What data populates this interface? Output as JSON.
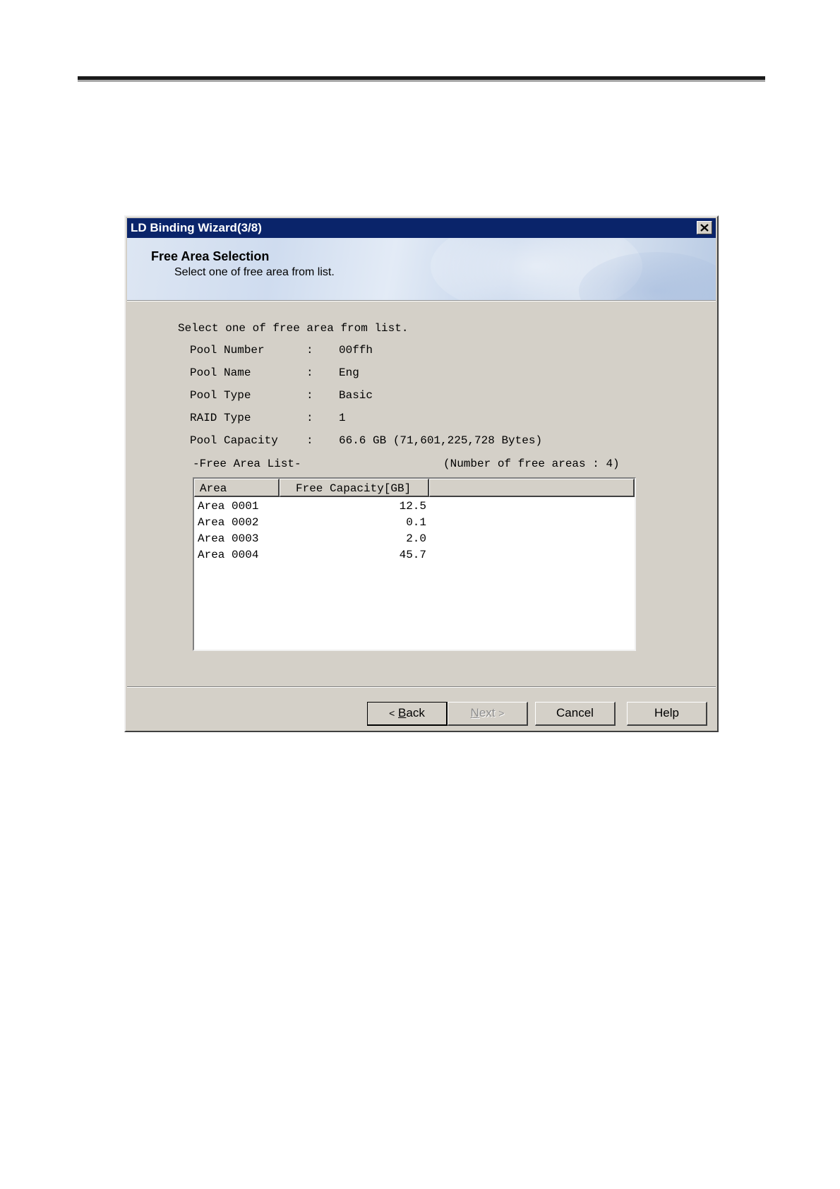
{
  "window": {
    "title": "LD Binding Wizard(3/8)",
    "close_glyph": "close-icon"
  },
  "banner": {
    "title": "Free Area Selection",
    "subtitle": "Select one of free area from list."
  },
  "body": {
    "intro": "Select one of free area from list.",
    "info": [
      {
        "label": "Pool Number",
        "colon": ":",
        "value": "00ffh"
      },
      {
        "label": "Pool Name",
        "colon": ":",
        "value": "Eng"
      },
      {
        "label": "Pool Type",
        "colon": ":",
        "value": "Basic"
      },
      {
        "label": "RAID Type",
        "colon": ":",
        "value": "1"
      },
      {
        "label": "Pool Capacity",
        "colon": ":",
        "value": "66.6 GB (71,601,225,728 Bytes)"
      }
    ],
    "list_title": "-Free Area List-",
    "list_count": "(Number of free areas : 4)"
  },
  "free_area_list": {
    "columns": [
      "Area",
      "Free Capacity[GB]",
      ""
    ],
    "rows": [
      {
        "area": "Area 0001",
        "capacity": "12.5"
      },
      {
        "area": "Area 0002",
        "capacity": "0.1"
      },
      {
        "area": "Area 0003",
        "capacity": "2.0"
      },
      {
        "area": "Area 0004",
        "capacity": "45.7"
      }
    ]
  },
  "buttons": {
    "back": {
      "arrow": "<",
      "mnemonic": "B",
      "rest": "ack"
    },
    "next": {
      "mnemonic": "N",
      "rest": "ext",
      "arrow": ">"
    },
    "cancel": "Cancel",
    "help": "Help"
  }
}
